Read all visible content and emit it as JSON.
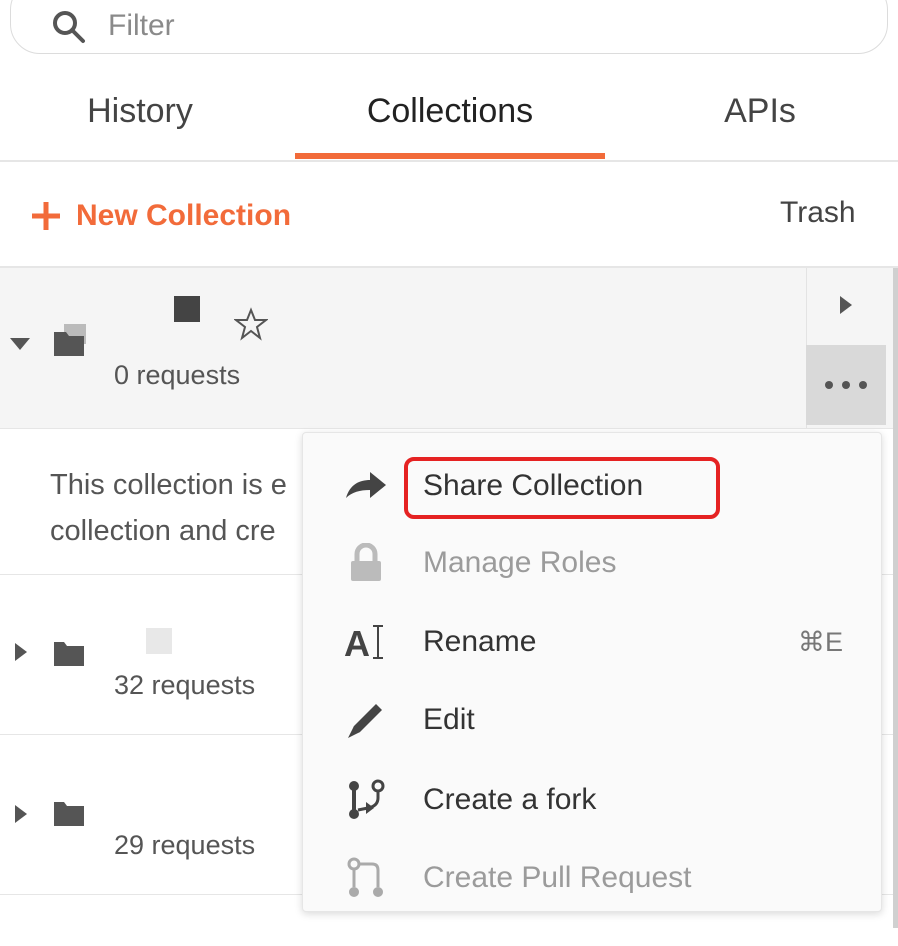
{
  "filter": {
    "placeholder": "Filter"
  },
  "tabs": [
    {
      "label": "History"
    },
    {
      "label": "Collections",
      "active": true
    },
    {
      "label": "APIs"
    }
  ],
  "toolbar": {
    "new_collection_label": "New Collection",
    "trash_label": "Trash"
  },
  "collections": [
    {
      "requests": "0 requests",
      "expanded": true
    },
    {
      "requests": "32 requests",
      "expanded": false
    },
    {
      "requests": "29 requests",
      "expanded": false
    }
  ],
  "empty_description": {
    "line1": "This collection is e",
    "line2": "collection and cre"
  },
  "context_menu": {
    "items": [
      {
        "label": "Share Collection",
        "icon": "share-arrow-icon",
        "enabled": true
      },
      {
        "label": "Manage Roles",
        "icon": "lock-icon",
        "enabled": false
      },
      {
        "label": "Rename",
        "icon": "rename-icon",
        "enabled": true,
        "shortcut": "⌘E"
      },
      {
        "label": "Edit",
        "icon": "pencil-icon",
        "enabled": true
      },
      {
        "label": "Create a fork",
        "icon": "fork-icon",
        "enabled": true
      },
      {
        "label": "Create Pull Request",
        "icon": "pull-request-icon",
        "enabled": false
      }
    ]
  },
  "colors": {
    "accent": "#f26b3a",
    "highlight": "#e52222"
  }
}
